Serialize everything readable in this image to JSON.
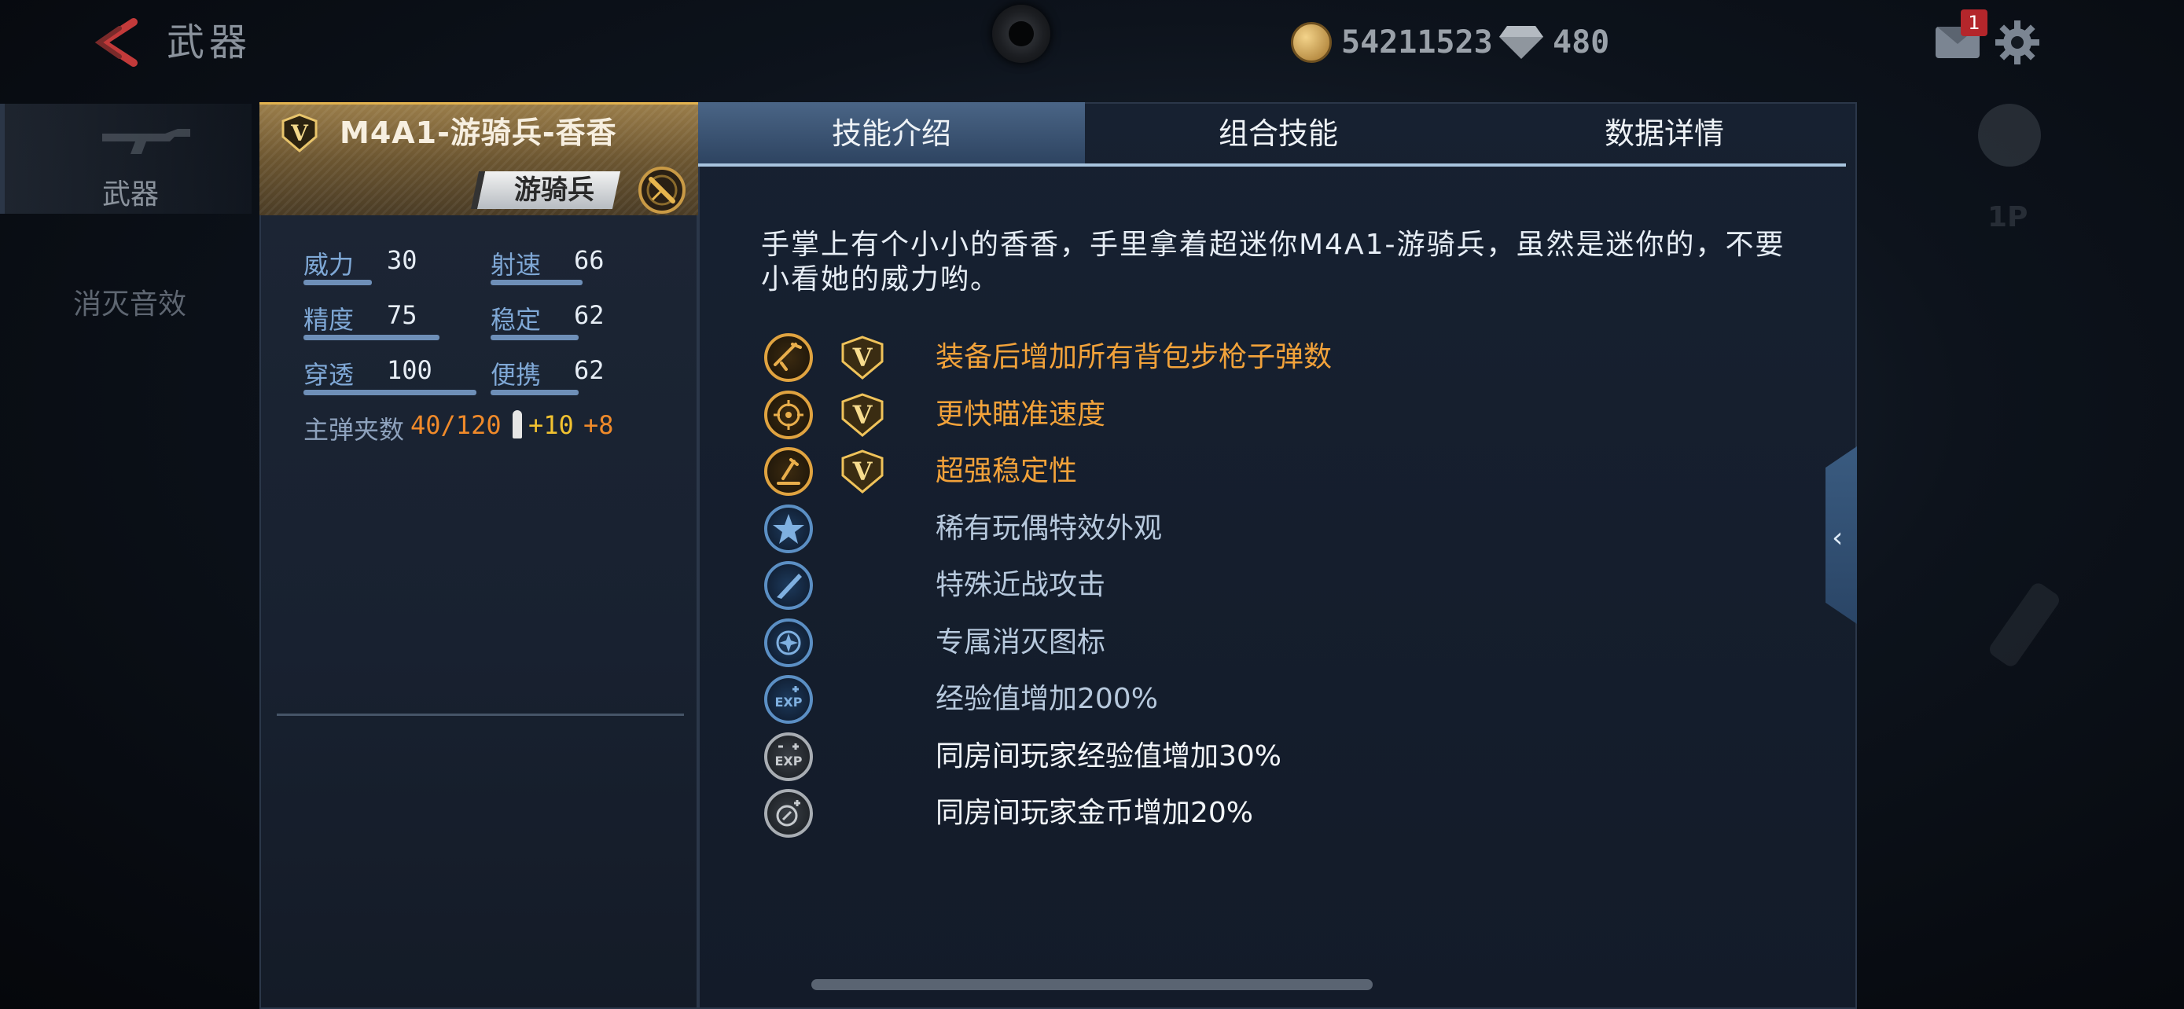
{
  "header": {
    "title": "武器",
    "coins": "54211523",
    "gems": "480",
    "mail_badge": "1"
  },
  "nav": {
    "weapon_label": "武器",
    "kill_effect_label": "消灭音效"
  },
  "right_controls": {
    "player_label": "1P"
  },
  "weapon": {
    "name": "M4A1-游骑兵-香香",
    "class_tag": "游骑兵",
    "stats": [
      {
        "label": "威力",
        "value": "30",
        "level": 0.3
      },
      {
        "label": "射速",
        "value": "66",
        "level": 0.66
      },
      {
        "label": "精度",
        "value": "75",
        "level": 0.75
      },
      {
        "label": "稳定",
        "value": "62",
        "level": 0.62
      },
      {
        "label": "穿透",
        "value": "100",
        "level": 1.0
      },
      {
        "label": "便携",
        "value": "62",
        "level": 0.62
      }
    ],
    "ammo_label": "主弹夹数",
    "ammo_value": "40/120",
    "ammo_bonus_1": "+10",
    "ammo_bonus_2": "+8"
  },
  "tabs": {
    "skill_intro": "技能介绍",
    "combo_skill": "组合技能",
    "data_details": "数据详情"
  },
  "description": "手掌上有个小小的香香，手里拿着超迷你M4A1-游骑兵，虽然是迷你的，不要小看她的威力哟。",
  "skills": [
    {
      "text": "装备后增加所有背包步枪子弹数",
      "icon": "rifle-icon",
      "style": "gold",
      "ranked": true
    },
    {
      "text": "更快瞄准速度",
      "icon": "crosshair-icon",
      "style": "gold",
      "ranked": true
    },
    {
      "text": "超强稳定性",
      "icon": "stability-icon",
      "style": "gold",
      "ranked": true
    },
    {
      "text": "稀有玩偶特效外观",
      "icon": "star-icon",
      "style": "blue",
      "ranked": false
    },
    {
      "text": "特殊近战攻击",
      "icon": "knife-icon",
      "style": "blue",
      "ranked": false
    },
    {
      "text": "专属消灭图标",
      "icon": "kill-mark-icon",
      "style": "blue",
      "ranked": false
    },
    {
      "text": "经验值增加200%",
      "icon": "exp-icon",
      "style": "blue",
      "ranked": false
    },
    {
      "text": "同房间玩家经验值增加30%",
      "icon": "team-exp-icon",
      "style": "grey",
      "ranked": false
    },
    {
      "text": "同房间玩家金币增加20%",
      "icon": "team-coin-icon",
      "style": "grey",
      "ranked": false
    }
  ],
  "colors": {
    "accent_gold": "#f2a23a",
    "tab_active": "#3d5675",
    "stat_label": "#7fa8d6",
    "ammo_orange": "#f08a2a"
  }
}
